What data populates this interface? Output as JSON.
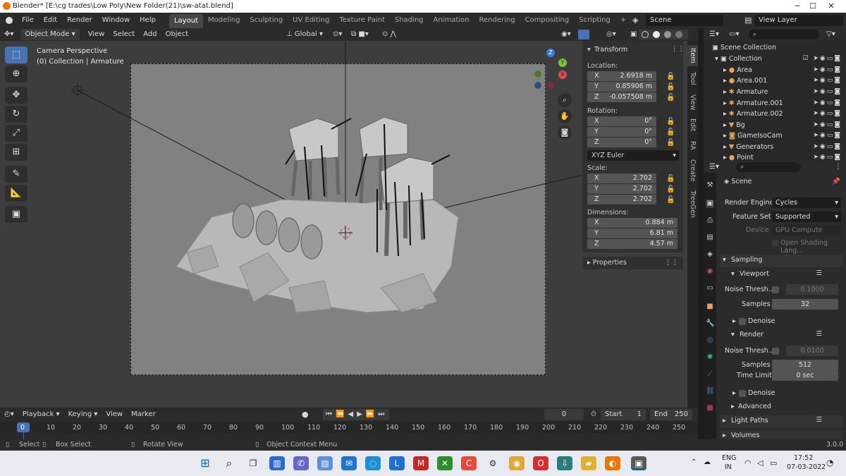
{
  "window": {
    "title": "Blender* [E:\\cg trades\\Low Poly\\New Folder(21)\\sw-atat.blend]",
    "minimize": "─",
    "maximize": "☐",
    "close": "✕"
  },
  "menubar": {
    "items": [
      "File",
      "Edit",
      "Render",
      "Window",
      "Help"
    ],
    "workspaces": [
      "Layout",
      "Modeling",
      "Sculpting",
      "UV Editing",
      "Texture Paint",
      "Shading",
      "Animation",
      "Rendering",
      "Compositing",
      "Scripting"
    ],
    "add_tab": "+",
    "scene": "Scene",
    "view_layer": "View Layer"
  },
  "viewport_header": {
    "mode": "Object Mode",
    "menus": [
      "View",
      "Select",
      "Add",
      "Object"
    ],
    "orientation": "Global"
  },
  "viewport": {
    "camera_label": "Camera Perspective",
    "collection_label": "(0) Collection | Armature",
    "gizmo": {
      "x": "X",
      "y": "Y",
      "z": "Z"
    }
  },
  "npanel": {
    "title": "Transform",
    "location_label": "Location:",
    "location": [
      {
        "axis": "X",
        "value": "2.6918 m"
      },
      {
        "axis": "Y",
        "value": "0.85906 m"
      },
      {
        "axis": "Z",
        "value": "-0.057508 m"
      }
    ],
    "rotation_label": "Rotation:",
    "rotation": [
      {
        "axis": "X",
        "value": "0°"
      },
      {
        "axis": "Y",
        "value": "0°"
      },
      {
        "axis": "Z",
        "value": "0°"
      }
    ],
    "rotation_mode": "XYZ Euler",
    "scale_label": "Scale:",
    "scale": [
      {
        "axis": "X",
        "value": "2.702"
      },
      {
        "axis": "Y",
        "value": "2.702"
      },
      {
        "axis": "Z",
        "value": "2.702"
      }
    ],
    "dimensions_label": "Dimensions:",
    "dimensions": [
      {
        "axis": "X",
        "value": "0.884 m"
      },
      {
        "axis": "Y",
        "value": "6.81 m"
      },
      {
        "axis": "Z",
        "value": "4.57 m"
      }
    ],
    "properties": "Properties",
    "tabs": [
      "Item",
      "Tool",
      "View",
      "Edit",
      "RA",
      "Create",
      "TreeGen"
    ]
  },
  "outliner": {
    "root": "Scene Collection",
    "collection": "Collection",
    "items": [
      "Area",
      "Area.001",
      "Armature",
      "Armature.001",
      "Armature.002",
      "Bg",
      "GameIsoCam",
      "Generators",
      "Point"
    ]
  },
  "properties": {
    "scene": "Scene",
    "render_engine_label": "Render Engine",
    "render_engine": "Cycles",
    "feature_set_label": "Feature Set",
    "feature_set": "Supported",
    "device_label": "Device",
    "device": "GPU Compute",
    "osl": "Open Shading Lang...",
    "sampling": "Sampling",
    "viewport": "Viewport",
    "noise_label": "Noise Thresh...",
    "viewport_noise": "0.1000",
    "samples_label": "Samples",
    "viewport_samples": "32",
    "denoise": "Denoise",
    "render": "Render",
    "render_noise": "0.0100",
    "render_samples": "512",
    "time_limit_label": "Time Limit",
    "time_limit": "0 sec",
    "advanced": "Advanced",
    "light_paths": "Light Paths",
    "volumes": "Volumes"
  },
  "timeline": {
    "menus": [
      "Playback",
      "Keying",
      "View",
      "Marker"
    ],
    "current_frame": "0",
    "start_label": "Start",
    "start": "1",
    "end_label": "End",
    "end": "250",
    "ticks": [
      "0",
      "10",
      "20",
      "30",
      "40",
      "50",
      "60",
      "70",
      "80",
      "90",
      "100",
      "110",
      "120",
      "130",
      "140",
      "150",
      "160",
      "170",
      "180",
      "190",
      "200",
      "210",
      "220",
      "230",
      "240",
      "250"
    ]
  },
  "statusbar": {
    "select": "Select",
    "box_select": "Box Select",
    "rotate_view": "Rotate View",
    "context_menu": "Object Context Menu",
    "version": "3.0.0"
  },
  "taskbar": {
    "lang1": "ENG",
    "lang2": "IN",
    "time": "17:52",
    "date": "07-03-2022"
  },
  "colors": {
    "accent": "#4772b3",
    "active_workspace": "#474747",
    "axis_x": "#e0485a",
    "axis_y": "#7ec23a",
    "axis_z": "#3a7bd5"
  }
}
